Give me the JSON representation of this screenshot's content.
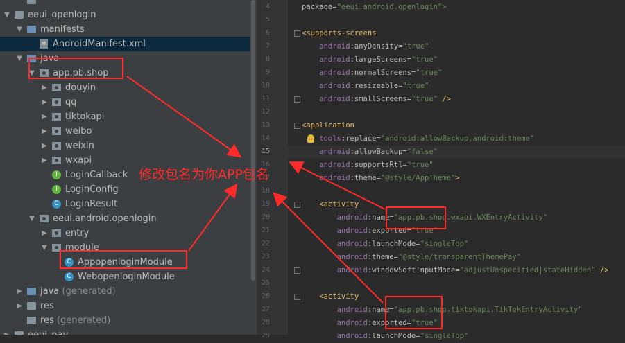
{
  "project_tree": [
    {
      "label": "",
      "kind": "folder",
      "depth": 1,
      "arrow": ""
    },
    {
      "label": "eeui_openlogin",
      "kind": "folder",
      "depth": 0,
      "arrow": "▼"
    },
    {
      "label": "manifests",
      "kind": "folder-blue",
      "depth": 1,
      "arrow": "▼"
    },
    {
      "label": "AndroidManifest.xml",
      "kind": "xml",
      "depth": 2,
      "arrow": "",
      "selected": true
    },
    {
      "label": "java",
      "kind": "folder-blue",
      "depth": 1,
      "arrow": "▼"
    },
    {
      "label": "app.pb.shop",
      "kind": "package",
      "depth": 2,
      "arrow": "▼"
    },
    {
      "label": "douyin",
      "kind": "package",
      "depth": 3,
      "arrow": "▶"
    },
    {
      "label": "qq",
      "kind": "package",
      "depth": 3,
      "arrow": "▶"
    },
    {
      "label": "tiktokapi",
      "kind": "package",
      "depth": 3,
      "arrow": "▶"
    },
    {
      "label": "weibo",
      "kind": "package",
      "depth": 3,
      "arrow": "▶"
    },
    {
      "label": "weixin",
      "kind": "package",
      "depth": 3,
      "arrow": "▶"
    },
    {
      "label": "wxapi",
      "kind": "package",
      "depth": 3,
      "arrow": "▶"
    },
    {
      "label": "LoginCallback",
      "kind": "interface",
      "depth": 3,
      "arrow": ""
    },
    {
      "label": "LoginConfig",
      "kind": "interface",
      "depth": 3,
      "arrow": ""
    },
    {
      "label": "LoginResult",
      "kind": "class",
      "depth": 3,
      "arrow": ""
    },
    {
      "label": "eeui.android.openlogin",
      "kind": "package",
      "depth": 2,
      "arrow": "▼"
    },
    {
      "label": "entry",
      "kind": "package",
      "depth": 3,
      "arrow": "▶"
    },
    {
      "label": "module",
      "kind": "package",
      "depth": 3,
      "arrow": "▼"
    },
    {
      "label": "AppopenloginModule",
      "kind": "class",
      "depth": 4,
      "arrow": ""
    },
    {
      "label": "WebopenloginModule",
      "kind": "class",
      "depth": 4,
      "arrow": ""
    },
    {
      "label": "java",
      "suffix": "(generated)",
      "kind": "folder-blue",
      "depth": 1,
      "arrow": "▶"
    },
    {
      "label": "res",
      "kind": "folder",
      "depth": 1,
      "arrow": "▶"
    },
    {
      "label": "res",
      "suffix": "(generated)",
      "kind": "folder",
      "depth": 1,
      "arrow": ""
    },
    {
      "label": "eeui_pay",
      "kind": "folder",
      "depth": 0,
      "arrow": "▶"
    }
  ],
  "editor": {
    "current_line": "15",
    "lines": [
      {
        "n": "4",
        "segs": [
          {
            "t": "package=",
            "c": "attr"
          },
          {
            "t": "\"eeui.android.openlogin\">",
            "c": "val"
          }
        ]
      },
      {
        "n": "5",
        "segs": []
      },
      {
        "n": "6",
        "fold": true,
        "segs": [
          {
            "t": "<supports-screens",
            "c": "tag"
          }
        ]
      },
      {
        "n": "7",
        "segs": [
          {
            "t": "    android",
            "c": "ns"
          },
          {
            "t": ":anyDensity=",
            "c": "attr"
          },
          {
            "t": "\"true\"",
            "c": "val"
          }
        ]
      },
      {
        "n": "8",
        "segs": [
          {
            "t": "    android",
            "c": "ns"
          },
          {
            "t": ":largeScreens=",
            "c": "attr"
          },
          {
            "t": "\"true\"",
            "c": "val"
          }
        ]
      },
      {
        "n": "9",
        "segs": [
          {
            "t": "    android",
            "c": "ns"
          },
          {
            "t": ":normalScreens=",
            "c": "attr"
          },
          {
            "t": "\"true\"",
            "c": "val"
          }
        ]
      },
      {
        "n": "10",
        "segs": [
          {
            "t": "    android",
            "c": "ns"
          },
          {
            "t": ":resizeable=",
            "c": "attr"
          },
          {
            "t": "\"true\"",
            "c": "val"
          }
        ]
      },
      {
        "n": "11",
        "fold": true,
        "segs": [
          {
            "t": "    android",
            "c": "ns"
          },
          {
            "t": ":smallScreens=",
            "c": "attr"
          },
          {
            "t": "\"true\"",
            "c": "val"
          },
          {
            "t": " />",
            "c": "tag"
          }
        ]
      },
      {
        "n": "12",
        "segs": []
      },
      {
        "n": "13",
        "fold": true,
        "segs": [
          {
            "t": "<application",
            "c": "tag"
          }
        ]
      },
      {
        "n": "14",
        "segs": [
          {
            "t": "    tools",
            "c": "ns"
          },
          {
            "t": ":replace=",
            "c": "attr"
          },
          {
            "t": "\"android:allowBackup,android:theme\"",
            "c": "val"
          }
        ]
      },
      {
        "n": "15",
        "segs": [
          {
            "t": "    android",
            "c": "ns"
          },
          {
            "t": ":allowBackup=",
            "c": "attr"
          },
          {
            "t": "\"false\"",
            "c": "val"
          }
        ]
      },
      {
        "n": "16",
        "segs": [
          {
            "t": "    android",
            "c": "ns"
          },
          {
            "t": ":supportsRtl=",
            "c": "attr"
          },
          {
            "t": "\"true\"",
            "c": "val"
          }
        ]
      },
      {
        "n": "17",
        "segs": [
          {
            "t": "    android",
            "c": "ns"
          },
          {
            "t": ":theme=",
            "c": "attr"
          },
          {
            "t": "\"@style/AppTheme\"",
            "c": "val"
          },
          {
            "t": ">",
            "c": "tag"
          }
        ]
      },
      {
        "n": "18",
        "segs": []
      },
      {
        "n": "19",
        "fold": true,
        "segs": [
          {
            "t": "    <activity",
            "c": "tag"
          }
        ]
      },
      {
        "n": "20",
        "segs": [
          {
            "t": "        android",
            "c": "ns"
          },
          {
            "t": ":name=",
            "c": "attr"
          },
          {
            "t": "\"app.pb.shop.wxapi.WXEntryActivity\"",
            "c": "val"
          }
        ]
      },
      {
        "n": "21",
        "segs": [
          {
            "t": "        android",
            "c": "ns"
          },
          {
            "t": ":exported=",
            "c": "attr"
          },
          {
            "t": "\"true\"",
            "c": "val"
          }
        ]
      },
      {
        "n": "22",
        "segs": [
          {
            "t": "        android",
            "c": "ns"
          },
          {
            "t": ":launchMode=",
            "c": "attr"
          },
          {
            "t": "\"singleTop\"",
            "c": "val"
          }
        ]
      },
      {
        "n": "23",
        "segs": [
          {
            "t": "        android",
            "c": "ns"
          },
          {
            "t": ":theme=",
            "c": "attr"
          },
          {
            "t": "\"@style/transparentThemePay\"",
            "c": "val"
          }
        ]
      },
      {
        "n": "24",
        "fold": true,
        "segs": [
          {
            "t": "        android",
            "c": "ns"
          },
          {
            "t": ":windowSoftInputMode=",
            "c": "attr"
          },
          {
            "t": "\"adjustUnspecified|stateHidden\"",
            "c": "val"
          },
          {
            "t": " />",
            "c": "tag"
          }
        ]
      },
      {
        "n": "25",
        "segs": []
      },
      {
        "n": "26",
        "fold": true,
        "segs": [
          {
            "t": "    <activity",
            "c": "tag"
          }
        ]
      },
      {
        "n": "27",
        "segs": [
          {
            "t": "        android",
            "c": "ns"
          },
          {
            "t": ":name=",
            "c": "attr"
          },
          {
            "t": "\"app.pb.shop.tiktokapi.TikTokEntryActivity\"",
            "c": "val"
          }
        ]
      },
      {
        "n": "28",
        "segs": [
          {
            "t": "        android",
            "c": "ns"
          },
          {
            "t": ":exported=",
            "c": "attr"
          },
          {
            "t": "\"true\"",
            "c": "val"
          }
        ]
      },
      {
        "n": "29",
        "segs": [
          {
            "t": "        android",
            "c": "ns"
          },
          {
            "t": ":launchMode=",
            "c": "attr"
          },
          {
            "t": "\"singleTop\"",
            "c": "val"
          }
        ]
      }
    ]
  },
  "annotation": {
    "text": "修改包名为你APP包名",
    "color": "#ff2a2a"
  },
  "colors": {
    "tree_bg": "#3c3f41",
    "editor_bg": "#2b2b2b",
    "selection": "#0d293e",
    "annotation": "#ff2a2a"
  }
}
